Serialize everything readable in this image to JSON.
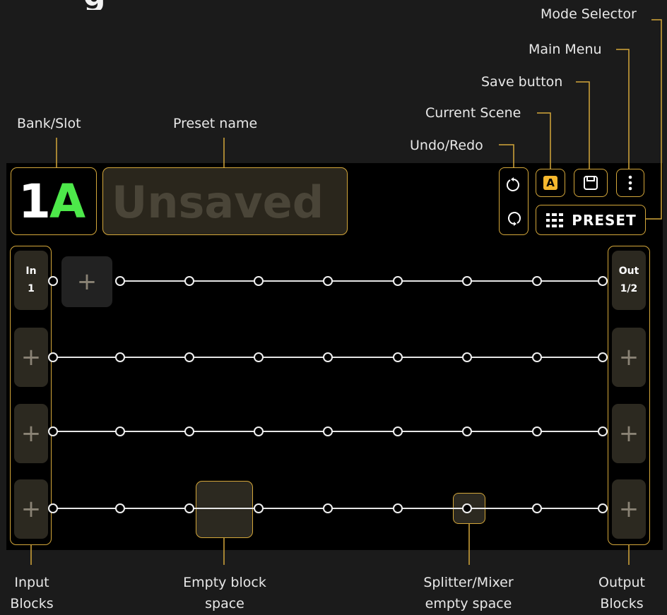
{
  "header_fragment": "g",
  "labels": {
    "mode_selector": "Mode Selector",
    "main_menu": "Main Menu",
    "save_button": "Save button",
    "current_scene": "Current Scene",
    "undo_redo": "Undo/Redo",
    "bank_slot": "Bank/Slot",
    "preset_name": "Preset name",
    "input_blocks": "Input Blocks",
    "empty_block_space": "Empty block space",
    "splitter_mixer": "Splitter/Mixer empty space",
    "output_blocks": "Output Blocks"
  },
  "screen": {
    "bank_number": "1",
    "bank_letter": "A",
    "preset_name": "Unsaved",
    "scene": "A",
    "mode": "PRESET",
    "input_label": "In",
    "input_value": "1",
    "output_label": "Out",
    "output_value": "1/2",
    "plus": "+"
  },
  "colors": {
    "accent": "#d4a73a",
    "scene_badge": "#f5b82e",
    "bank_letter": "#4de84a",
    "background": "#1b1b1b",
    "screen": "#000000"
  },
  "icons": [
    "undo-icon",
    "redo-icon",
    "save-icon",
    "menu-dots-icon",
    "grid-icon",
    "plus-icon"
  ]
}
